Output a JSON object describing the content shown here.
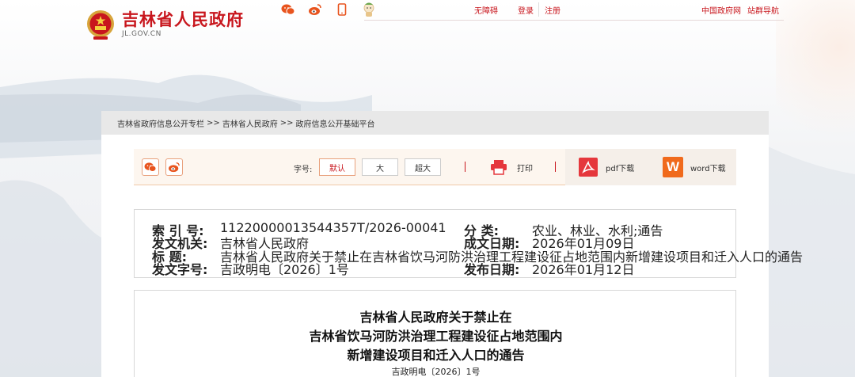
{
  "site": {
    "title": "吉林省人民政府",
    "domain": "JL.GOV.CN"
  },
  "topbar": {
    "social_icons": [
      "wechat-icon",
      "weibo-icon",
      "mobile-icon",
      "mascot-icon"
    ],
    "accessibility": "无障碍",
    "login": "登录",
    "register": "注册",
    "gov_cn": "中国政府网",
    "site_nav": "站群导航"
  },
  "breadcrumb": [
    "吉林省政府信息公开专栏",
    "吉林省人民政府",
    "政府信息公开基础平台"
  ],
  "breadcrumb_sep": ">>",
  "toolbar": {
    "font_size_label": "字号:",
    "sizes": [
      "默认",
      "大",
      "超大"
    ],
    "active_size": "默认",
    "print": "打印",
    "pdf_download": "pdf下载",
    "word_download": "word下载",
    "word_glyph": "W"
  },
  "meta": {
    "index_label": "索 引 号:",
    "index_value": "11220000013544357T/2026-00041",
    "category_label": "分 类:",
    "category_value": "农业、林业、水利;通告",
    "issuer_label": "发文机关:",
    "issuer_value": "吉林省人民政府",
    "date_written_label": "成文日期:",
    "date_written_value": "2026年01月09日",
    "subject_label": "标 题:",
    "subject_value": "吉林省人民政府关于禁止在吉林省饮马河防洪治理工程建设征占地范围内新增建设项目和迁入人口的通告",
    "doc_no_label": "发文字号:",
    "doc_no_value": "吉政明电〔2026〕1号",
    "publish_date_label": "发布日期:",
    "publish_date_value": "2026年01月12日"
  },
  "document": {
    "title_line1": "吉林省人民政府关于禁止在",
    "title_line2": "吉林省饮马河防洪治理工程建设征占地范围内",
    "title_line3": "新增建设项目和迁入人口的通告",
    "doc_number": "吉政明电〔2026〕1号"
  },
  "colors": {
    "brand_red": "#c8161d",
    "wechat_green": "#2aae67",
    "weibo_orange": "#e8541e",
    "pdf_red": "#e5373c",
    "word_orange": "#f06a1c"
  }
}
